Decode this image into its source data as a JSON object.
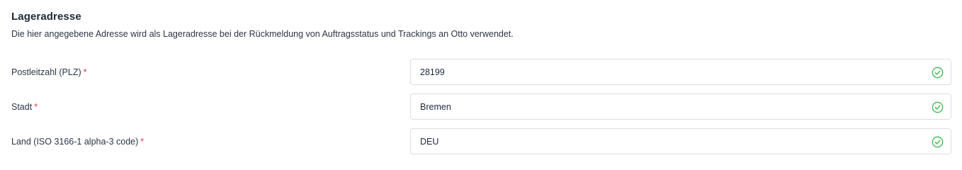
{
  "section": {
    "title": "Lageradresse",
    "description": "Die hier angegebene Adresse wird als Lageradresse bei der Rückmeldung von Auftragsstatus und Trackings an Otto verwendet."
  },
  "fields": [
    {
      "label": "Postleitzahl (PLZ)",
      "required_marker": "*",
      "value": "28199",
      "status_icon": "check-circle-icon"
    },
    {
      "label": "Stadt",
      "required_marker": "*",
      "value": "Bremen",
      "status_icon": "check-circle-icon"
    },
    {
      "label": "Land (ISO 3166-1 alpha-3 code)",
      "required_marker": "*",
      "value": "DEU",
      "status_icon": "check-circle-icon"
    }
  ],
  "colors": {
    "required": "#e0384a",
    "valid": "#3fb950",
    "border": "#d9dfe7"
  }
}
